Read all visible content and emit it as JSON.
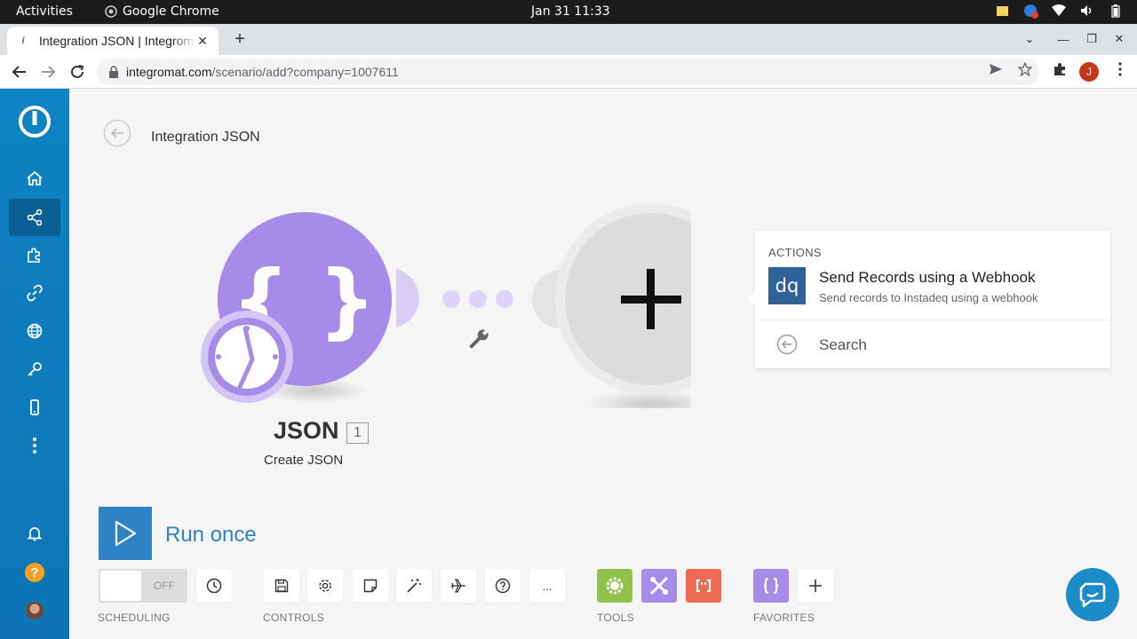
{
  "system": {
    "activities": "Activities",
    "app_name": "Google Chrome",
    "clock": "Jan 31  11:33"
  },
  "browser": {
    "tab_title": "Integration JSON | Integromat",
    "url_host": "integromat.com",
    "url_path": "/scenario/add?company=1007611",
    "profile_initial": "J"
  },
  "scenario": {
    "name": "Integration JSON",
    "module": {
      "title": "JSON",
      "badge": "1",
      "subtitle": "Create JSON",
      "color": "#a68be8"
    }
  },
  "popup": {
    "section_label": "ACTIONS",
    "app_icon_text": "dq",
    "action_title": "Send Records using a Webhook",
    "action_desc": "Send records to Instadeq using a webhook",
    "search_label": "Search"
  },
  "run": {
    "label": "Run once"
  },
  "toolbar": {
    "scheduling_state": "OFF",
    "sections": {
      "scheduling": "SCHEDULING",
      "controls": "CONTROLS",
      "tools": "TOOLS",
      "favorites": "FAVORITES"
    },
    "more_label": "...",
    "tool_colors": {
      "flow": "#8fc14b",
      "tools": "#a68be8",
      "text": "#ef6a55",
      "favorite_json": "#a68be8"
    }
  },
  "colors": {
    "sidebar": "#0e82c2",
    "accent": "#2d83c6",
    "module_purple": "#a68be8",
    "add_module_gray": "#dcdcdc"
  }
}
